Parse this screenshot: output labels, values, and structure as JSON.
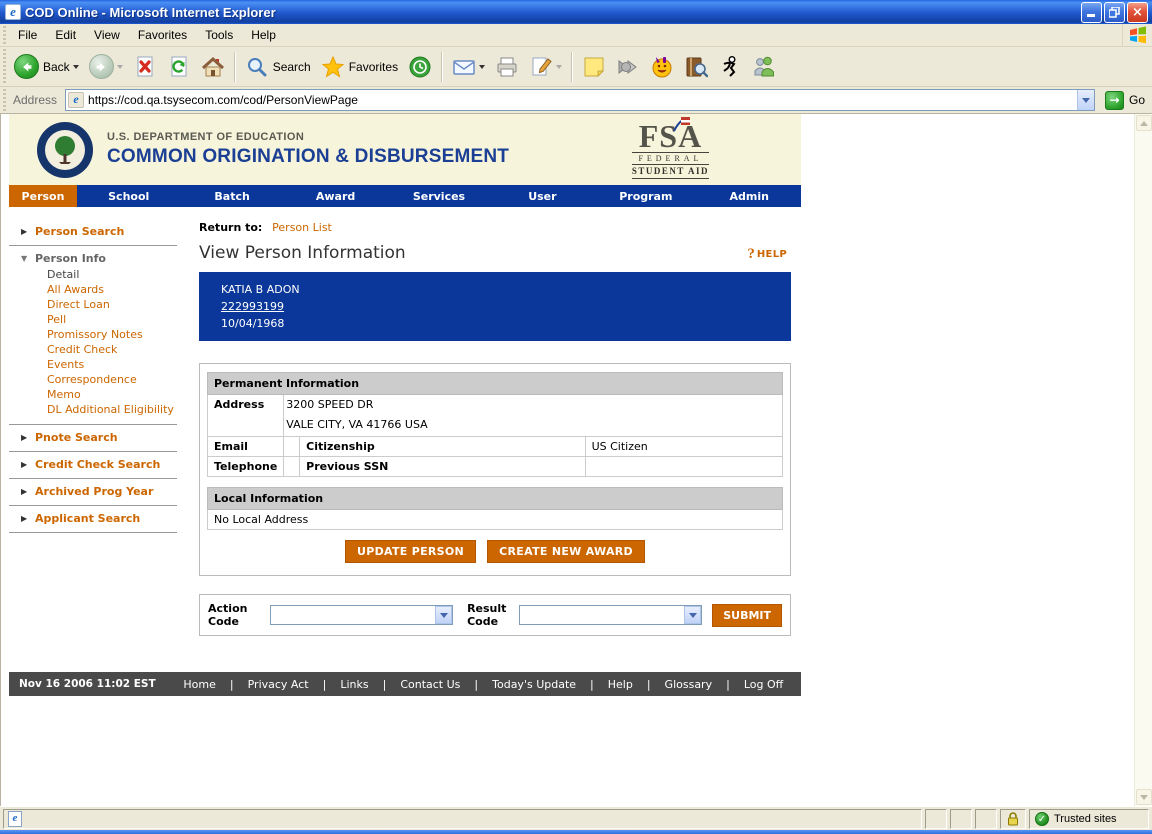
{
  "colors": {
    "accent_orange": "#cc6600",
    "nav_blue": "#0a3799",
    "header_beige": "#f6f4db",
    "footer_gray": "#4a4a4a",
    "table_header_gray": "#cccccc",
    "titlebar_blue": "#2157ce"
  },
  "window": {
    "title": "COD Online - Microsoft Internet Explorer",
    "menu": [
      "File",
      "Edit",
      "View",
      "Favorites",
      "Tools",
      "Help"
    ],
    "toolbar": {
      "back": "Back",
      "search": "Search",
      "favorites": "Favorites"
    },
    "address": {
      "label": "Address",
      "url": "https://cod.qa.tsysecom.com/cod/PersonViewPage",
      "go": "Go"
    },
    "status": {
      "zone": "Trusted sites"
    }
  },
  "site": {
    "header": {
      "dept": "U.S. DEPARTMENT OF EDUCATION",
      "app": "COMMON ORIGINATION & DISBURSEMENT",
      "fsa_acronym": "FSA",
      "fsa_line1": "FEDERAL",
      "fsa_line2": "STUDENT AID"
    },
    "nav": [
      "Person",
      "School",
      "Batch",
      "Award",
      "Services",
      "User",
      "Program",
      "Admin"
    ],
    "sidebar": {
      "s0": "Person Search",
      "s1": "Person Info",
      "s1_children": [
        "Detail",
        "All Awards",
        "Direct Loan",
        "Pell",
        "Promissory Notes",
        "Credit Check",
        "Events",
        "Correspondence",
        "Memo",
        "DL Additional Eligibility"
      ],
      "s2": "Pnote Search",
      "s3": "Credit Check Search",
      "s4": "Archived Prog Year",
      "s5": "Applicant Search"
    },
    "main": {
      "return_label": "Return to:",
      "return_link": "Person List",
      "title": "View Person Information",
      "help": "HELP",
      "person": {
        "name": "KATIA B ADON",
        "ssn": "222993199",
        "dob": "10/04/1968"
      },
      "permanent": {
        "title": "Permanent Information",
        "address_label": "Address",
        "address_line1": "3200 SPEED DR",
        "address_line2": "VALE CITY, VA 41766 USA",
        "email_label": "Email",
        "email_value": "",
        "citizenship_label": "Citizenship",
        "citizenship_value": "US Citizen",
        "telephone_label": "Telephone",
        "previous_ssn_label": "Previous SSN",
        "previous_ssn_value": ""
      },
      "local": {
        "title": "Local Information",
        "value": "No Local Address"
      },
      "buttons": {
        "update": "UPDATE PERSON",
        "create": "CREATE NEW AWARD"
      },
      "action": {
        "action_label": "Action Code",
        "result_label": "Result Code",
        "submit": "SUBMIT"
      }
    },
    "footer": {
      "timestamp": "Nov 16 2006 11:02 EST",
      "links": [
        "Home",
        "Privacy Act",
        "Links",
        "Contact Us",
        "Today's Update",
        "Help",
        "Glossary",
        "Log Off"
      ]
    }
  }
}
